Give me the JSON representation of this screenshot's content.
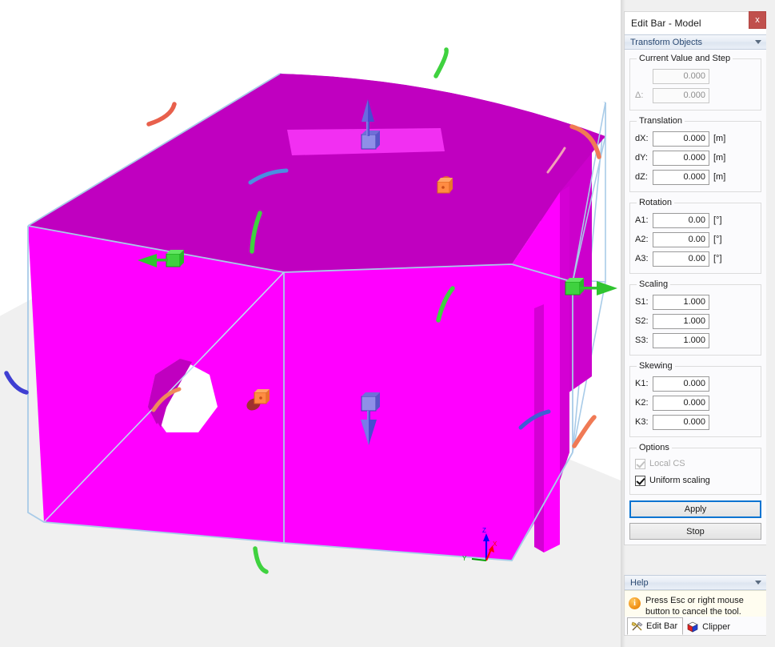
{
  "window": {
    "title": "Edit Bar - Model",
    "close_label": "x",
    "close_icon": "close-icon"
  },
  "section": {
    "label": "Transform Objects",
    "caret_icon": "chevron-down-icon"
  },
  "current_value": {
    "legend": "Current Value and Step",
    "value": "0.000",
    "step_label": "Δ:",
    "step_value": "0.000"
  },
  "translation": {
    "legend": "Translation",
    "fields": [
      {
        "label": "dX:",
        "value": "0.000",
        "unit": "[m]"
      },
      {
        "label": "dY:",
        "value": "0.000",
        "unit": "[m]"
      },
      {
        "label": "dZ:",
        "value": "0.000",
        "unit": "[m]"
      }
    ]
  },
  "rotation": {
    "legend": "Rotation",
    "fields": [
      {
        "label": "A1:",
        "value": "0.00",
        "unit": "[°]"
      },
      {
        "label": "A2:",
        "value": "0.00",
        "unit": "[°]"
      },
      {
        "label": "A3:",
        "value": "0.00",
        "unit": "[°]"
      }
    ]
  },
  "scaling": {
    "legend": "Scaling",
    "fields": [
      {
        "label": "S1:",
        "value": "1.000",
        "unit": ""
      },
      {
        "label": "S2:",
        "value": "1.000",
        "unit": ""
      },
      {
        "label": "S3:",
        "value": "1.000",
        "unit": ""
      }
    ]
  },
  "skewing": {
    "legend": "Skewing",
    "fields": [
      {
        "label": "K1:",
        "value": "0.000",
        "unit": ""
      },
      {
        "label": "K2:",
        "value": "0.000",
        "unit": ""
      },
      {
        "label": "K3:",
        "value": "0.000",
        "unit": ""
      }
    ]
  },
  "options": {
    "legend": "Options",
    "local_cs": {
      "label": "Local CS",
      "checked": true,
      "enabled": false
    },
    "uniform_scaling": {
      "label": "Uniform scaling",
      "checked": true,
      "enabled": true
    }
  },
  "buttons": {
    "apply": "Apply",
    "stop": "Stop"
  },
  "help": {
    "header": "Help",
    "caret_icon": "chevron-down-icon",
    "info_icon": "info-icon",
    "info_glyph": "i",
    "message": "Press Esc or right mouse button to cancel the tool."
  },
  "tabs": [
    {
      "label": "Edit Bar",
      "icon": "tools-icon",
      "active": true
    },
    {
      "label": "Clipper",
      "icon": "cube-icon",
      "active": false
    }
  ],
  "viewport": {
    "axis_labels": {
      "x": "X",
      "y": "Y",
      "z": "Z"
    },
    "colors": {
      "model_front": "#ff00ff",
      "model_top": "#c000c0",
      "bbox_edge": "#a8cbe8",
      "gizmo_x": "#e8604c",
      "gizmo_y": "#3fd23f",
      "gizmo_z": "#3f3fd2",
      "ground": "#f0f0f0",
      "background": "#ffffff",
      "handle_orange": "#ff8c42"
    }
  }
}
